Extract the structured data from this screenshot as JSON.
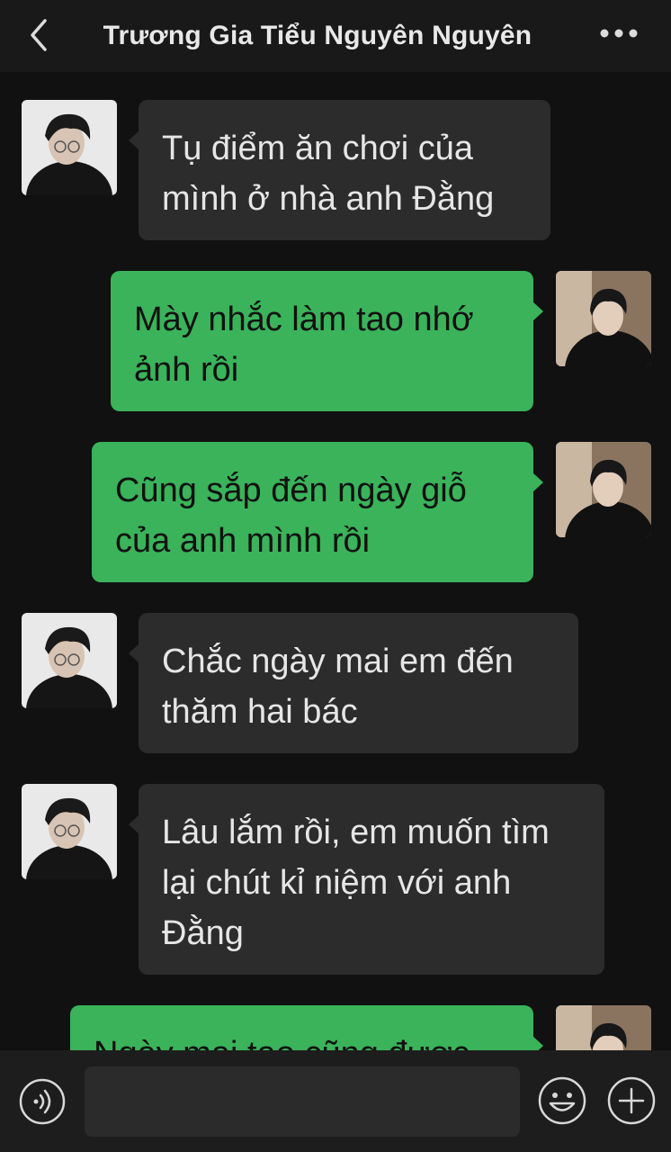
{
  "header": {
    "title": "Trương Gia Tiểu Nguyên Nguyên",
    "back_icon": "chevron-left-icon",
    "more_icon": "more-dots-icon"
  },
  "messages": [
    {
      "side": "in",
      "text": "Tụ điểm ăn chơi của mình ở nhà anh Đằng"
    },
    {
      "side": "out",
      "text": "Mày nhắc làm tao nhớ ảnh rồi"
    },
    {
      "side": "out",
      "text": "Cũng sắp đến ngày giỗ của anh mình rồi"
    },
    {
      "side": "in",
      "text": "Chắc ngày mai em đến thăm hai bác"
    },
    {
      "side": "in",
      "text": "Lâu lắm rồi, em muốn tìm lại chút kỉ niệm với anh Đằng"
    },
    {
      "side": "out",
      "text": "Ngày mai tao cũng được"
    }
  ],
  "footer": {
    "voice_icon": "voice-icon",
    "emoji_icon": "emoji-icon",
    "plus_icon": "plus-icon",
    "input_value": ""
  },
  "colors": {
    "background": "#111111",
    "incoming_bubble": "#2c2c2c",
    "outgoing_bubble": "#3ab35a"
  }
}
